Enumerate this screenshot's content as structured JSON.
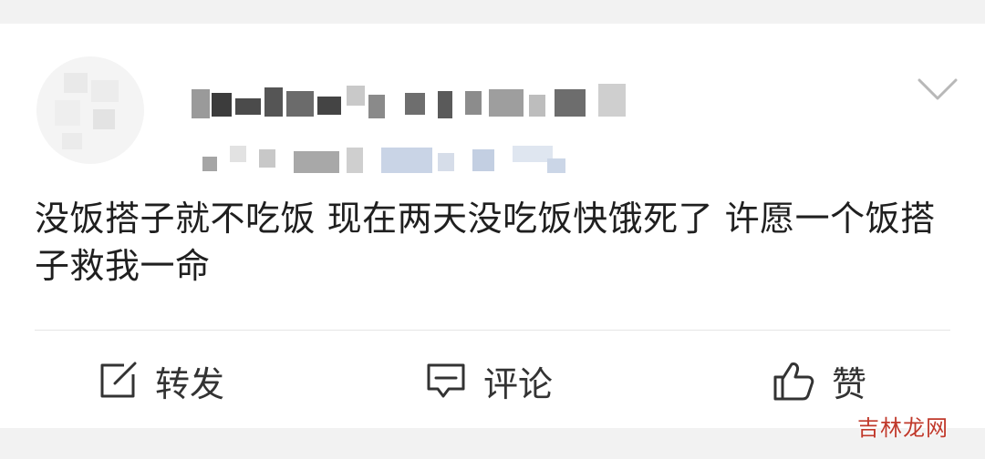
{
  "post": {
    "text": "没饭搭子就不吃饭 现在两天没吃饭快饿死了 许愿一个饭搭子救我一命"
  },
  "actions": {
    "repost_label": "转发",
    "comment_label": "评论",
    "like_label": "赞"
  },
  "watermark": {
    "text": "吉林龙网"
  },
  "icons": {
    "repost": "share-edit-icon",
    "comment": "comment-bubble-icon",
    "like": "thumbs-up-icon",
    "more": "chevron-down-icon"
  },
  "colors": {
    "page_bg": "#f2f2f2",
    "card_bg": "#ffffff",
    "text": "#1f1f1f",
    "watermark": "#c0392b"
  }
}
